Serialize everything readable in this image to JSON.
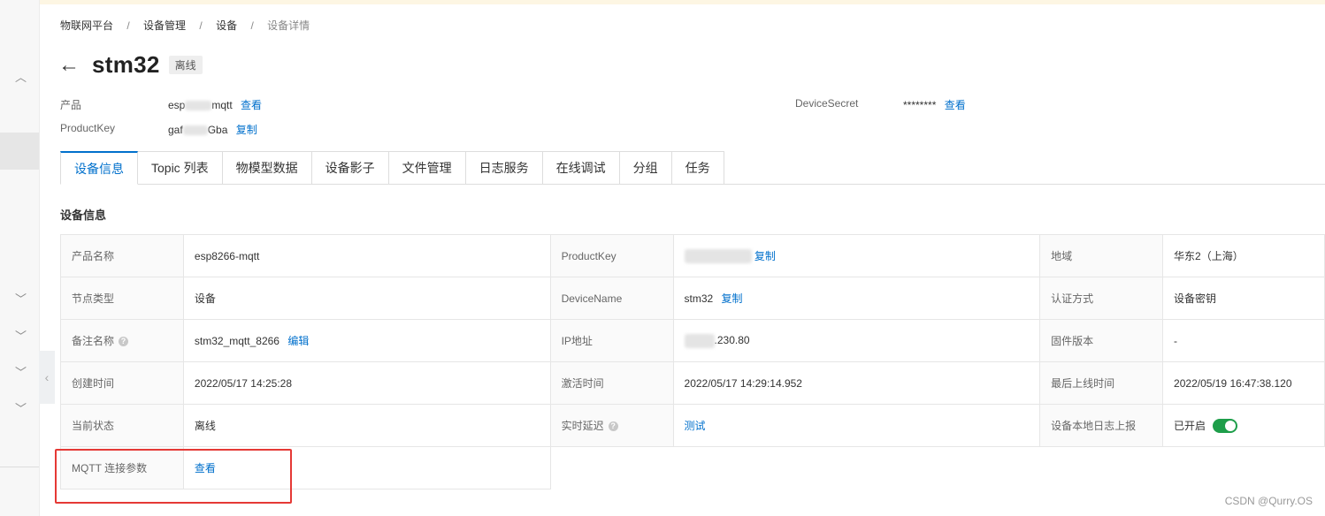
{
  "breadcrumb": {
    "items": [
      "物联网平台",
      "设备管理",
      "设备"
    ],
    "current": "设备详情",
    "separator": "/"
  },
  "device": {
    "name": "stm32",
    "status": "离线"
  },
  "meta": {
    "product_label": "产品",
    "product_prefix": "esp",
    "product_suffix": "mqtt",
    "product_action": "查看",
    "productkey_label": "ProductKey",
    "productkey_prefix": "gaf",
    "productkey_suffix": "Gba",
    "productkey_action": "复制",
    "secret_label": "DeviceSecret",
    "secret_value": "********",
    "secret_action": "查看"
  },
  "tabs": [
    "设备信息",
    "Topic 列表",
    "物模型数据",
    "设备影子",
    "文件管理",
    "日志服务",
    "在线调试",
    "分组",
    "任务"
  ],
  "section_title": "设备信息",
  "table": {
    "product_name_label": "产品名称",
    "product_name": "esp8266-mqtt",
    "productkey_label": "ProductKey",
    "copy": "复制",
    "region_label": "地域",
    "region": "华东2（上海）",
    "node_type_label": "节点类型",
    "node_type": "设备",
    "devicename_label": "DeviceName",
    "devicename": "stm32",
    "auth_label": "认证方式",
    "auth": "设备密钥",
    "alias_label": "备注名称",
    "alias": "stm32_mqtt_8266",
    "edit": "编辑",
    "ip_label": "IP地址",
    "ip_suffix": ".230.80",
    "firmware_label": "固件版本",
    "firmware": "-",
    "created_label": "创建时间",
    "created": "2022/05/17 14:25:28",
    "activated_label": "激活时间",
    "activated": "2022/05/17 14:29:14.952",
    "last_online_label": "最后上线时间",
    "last_online": "2022/05/19 16:47:38.120",
    "state_label": "当前状态",
    "state": "离线",
    "latency_label": "实时延迟",
    "latency_action": "测试",
    "local_log_label": "设备本地日志上报",
    "local_log": "已开启",
    "mqtt_label": "MQTT 连接参数",
    "mqtt_action": "查看"
  },
  "watermark": "CSDN @Qurry.OS",
  "colors": {
    "link": "#0070cc",
    "toggle_on": "#1e9e4a",
    "highlight": "#e53935"
  }
}
